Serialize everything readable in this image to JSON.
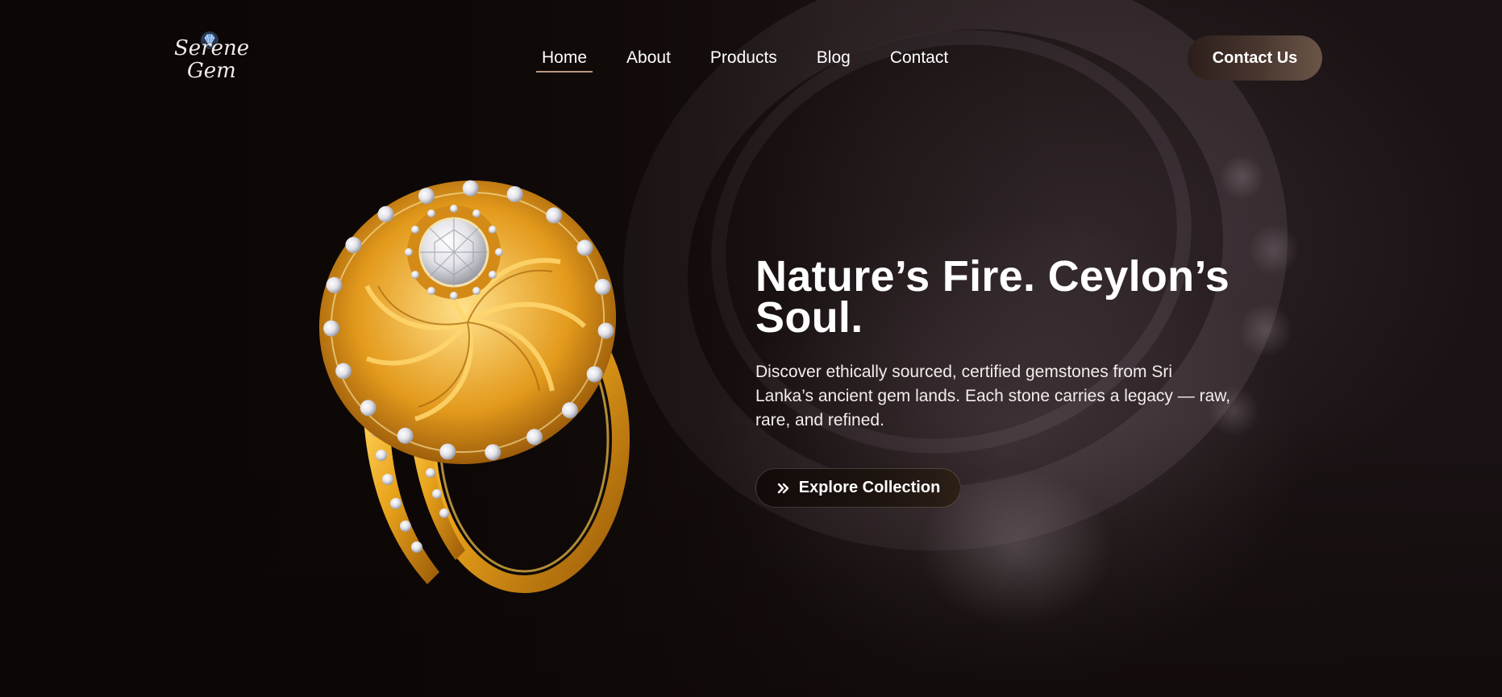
{
  "brand": {
    "logo_line1": "Serene",
    "logo_line2": "Gem",
    "logo_icon": "diamond-icon"
  },
  "nav": {
    "items": [
      {
        "label": "Home",
        "active": true
      },
      {
        "label": "About",
        "active": false
      },
      {
        "label": "Products",
        "active": false
      },
      {
        "label": "Blog",
        "active": false
      },
      {
        "label": "Contact",
        "active": false
      }
    ],
    "cta_label": "Contact Us"
  },
  "hero": {
    "title": "Nature’s Fire. Ceylon’s Soul.",
    "description": "Discover ethically sourced, certified gemstones from Sri Lanka’s ancient gem  lands. Each stone carries a legacy — raw, rare, and refined.",
    "button_label": "Explore Collection",
    "button_icon": "double-chevron-right-icon"
  },
  "colors": {
    "background": "#110b0a",
    "accent_underline": "#b79a84",
    "cta_gradient_end": "#6b5547",
    "gold": "#e8a21a"
  }
}
